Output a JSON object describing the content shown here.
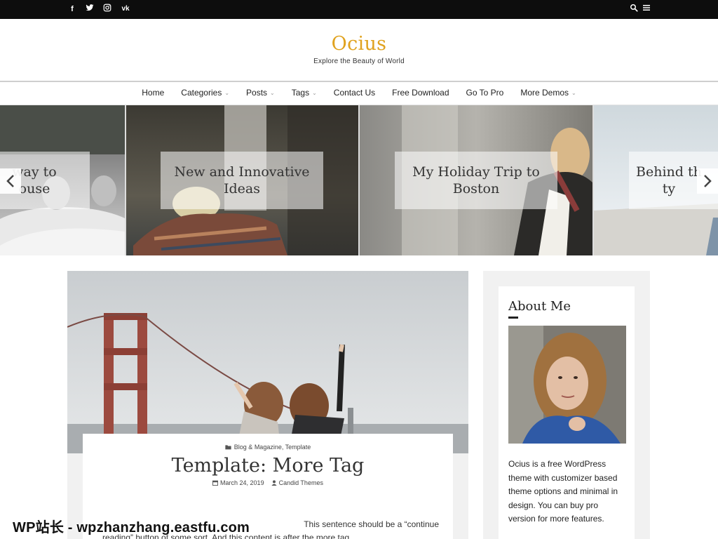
{
  "topbar": {
    "social": [
      "f",
      "t",
      "ig",
      "vk"
    ],
    "icons": [
      "facebook-icon",
      "twitter-icon",
      "instagram-icon",
      "vk-icon",
      "search-icon",
      "menu-icon"
    ]
  },
  "header": {
    "title": "Ocius",
    "tagline": "Explore the Beauty of World"
  },
  "nav": {
    "items": [
      {
        "label": "Home",
        "dropdown": false
      },
      {
        "label": "Categories",
        "dropdown": true
      },
      {
        "label": "Posts",
        "dropdown": true
      },
      {
        "label": "Tags",
        "dropdown": true
      },
      {
        "label": "Contact Us",
        "dropdown": false
      },
      {
        "label": "Free Download",
        "dropdown": false
      },
      {
        "label": "Go To Pro",
        "dropdown": false
      },
      {
        "label": "More Demos",
        "dropdown": true
      }
    ]
  },
  "slider": {
    "slides": [
      {
        "caption": "way to\nouse"
      },
      {
        "caption": "New and Innovative Ideas"
      },
      {
        "caption": "My Holiday Trip to Boston"
      },
      {
        "caption": "Behind th\nty"
      }
    ],
    "prev_icon": "chevron-left-icon",
    "next_icon": "chevron-right-icon"
  },
  "post": {
    "categories": "Blog & Magazine, Template",
    "title": "Template: More Tag",
    "date": "March 24, 2019",
    "author": "Candid Themes",
    "excerpt_line1": "This sentence should be a “continue",
    "excerpt_line2": "reading” button of some sort. And this content is after the more tag."
  },
  "sidebar": {
    "widget_title": "About Me",
    "about_text": "Ocius is a free WordPress theme with customizer based theme options and minimal in design. You can buy pro version for more features."
  },
  "watermark": "WP站长 - wpzhanzhang.eastfu.com",
  "colors": {
    "accent": "#e0a21e",
    "topbar": "#0d0d0d"
  }
}
